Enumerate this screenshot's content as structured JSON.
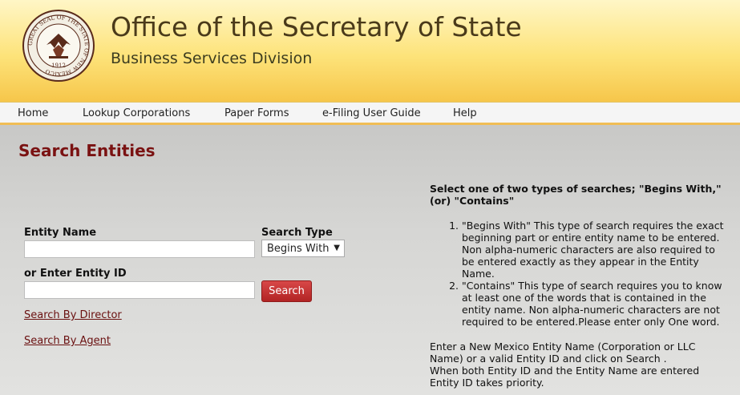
{
  "header": {
    "title": "Office of the Secretary of State",
    "subtitle": "Business Services Division",
    "seal_text": "GREAT SEAL OF THE STATE OF NEW MEXICO",
    "seal_year": "1912"
  },
  "nav": {
    "items": [
      {
        "label": "Home"
      },
      {
        "label": "Lookup Corporations"
      },
      {
        "label": "Paper Forms"
      },
      {
        "label": "e-Filing User Guide"
      },
      {
        "label": "Help"
      }
    ]
  },
  "search": {
    "page_title": "Search Entities",
    "entity_name_label": "Entity Name",
    "entity_name_value": "",
    "search_type_label": "Search Type",
    "search_type_selected": "Begins With",
    "entity_id_label": "or Enter Entity ID",
    "entity_id_value": "",
    "search_button": "Search",
    "link_director": "Search By Director",
    "link_agent": "Search By Agent"
  },
  "help": {
    "heading": "Select one of two types of searches; \"Begins With,\" (or) \"Contains\"",
    "items": [
      "\"Begins With\" This type of search requires the exact beginning part or entire entity name to be entered. Non alpha-numeric characters are also required to be entered exactly as they appear in the Entity Name.",
      " \"Contains\" This type of search requires you to know at least one of the words that is contained in the entity name. Non alpha-numeric characters are not required to be entered.Please enter only One word."
    ],
    "paragraph1": "Enter a New Mexico Entity Name (Corporation or LLC Name) or a valid Entity ID and click on Search .",
    "paragraph2": "When both Entity ID and the Entity Name are entered Entity ID takes priority."
  },
  "colors": {
    "accent": "#7a1212",
    "button": "#c33333",
    "header_yellow": "#fde37a"
  }
}
